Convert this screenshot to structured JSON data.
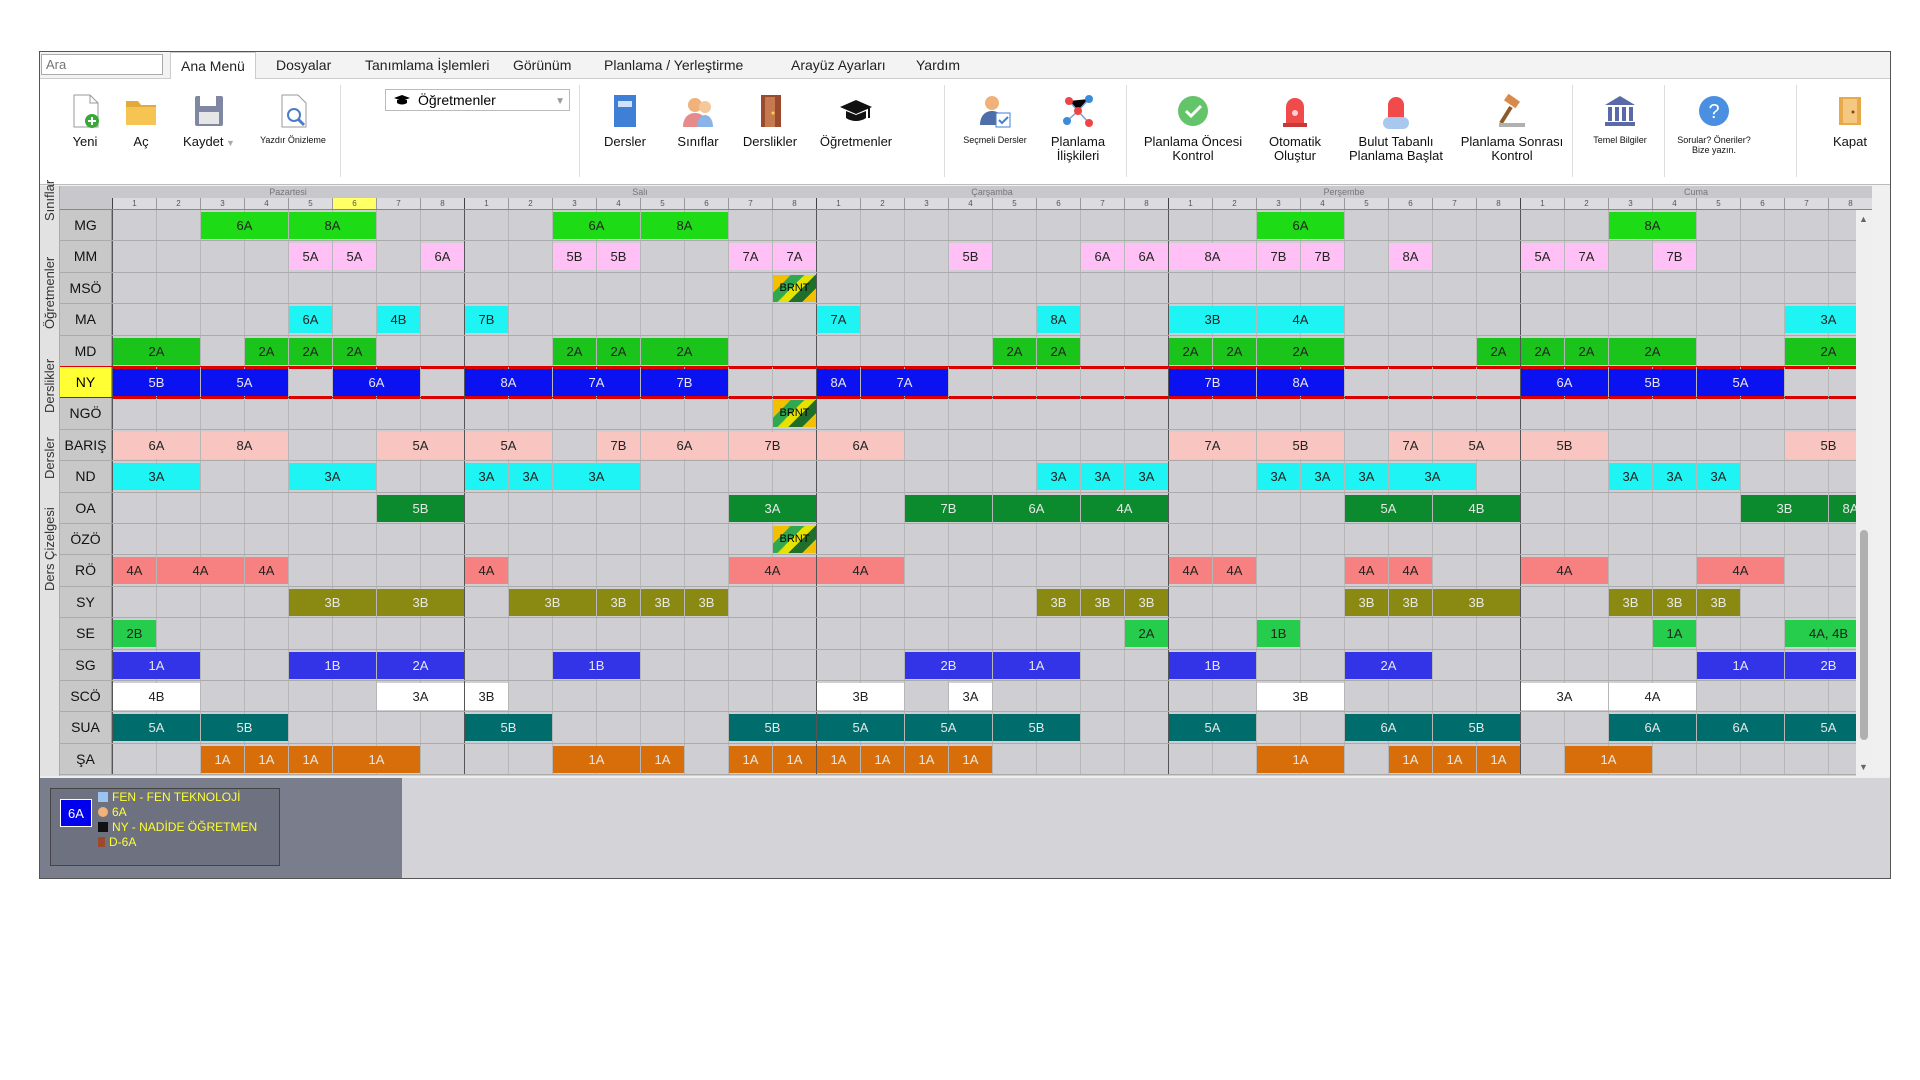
{
  "search": {
    "placeholder": "Ara"
  },
  "menu": [
    "Ana Menü",
    "Dosyalar",
    "Tanımlama İşlemleri",
    "Görünüm",
    "Planlama / Yerleştirme",
    "Arayüz Ayarları",
    "Yardım"
  ],
  "ribbon": {
    "new": "Yeni",
    "open": "Aç",
    "save": "Kaydet",
    "print_preview": "Yazdır Önizleme",
    "selector": "Öğretmenler",
    "lessons": "Dersler",
    "classes": "Sınıflar",
    "classrooms": "Derslikler",
    "teachers": "Öğretmenler",
    "elective": "Seçmeli Dersler",
    "relations": "Planlama İlişkileri",
    "precheck": "Planlama Öncesi Kontrol",
    "auto": "Otomatik Oluştur",
    "cloud": "Bulut Tabanlı Planlama Başlat",
    "postcheck": "Planlama Sonrası Kontrol",
    "basic": "Temel Bilgiler",
    "questions": "Sorular? Öneriler? Bize yazın.",
    "close": "Kapat"
  },
  "side_tabs": [
    "Sınıflar",
    "Öğretmenler",
    "Derslikler",
    "Dersler",
    "Ders Çizelgesi"
  ],
  "days": [
    "Pazartesi",
    "Salı",
    "Çarşamba",
    "Perşembe",
    "Cuma"
  ],
  "periods": [
    "1",
    "2",
    "3",
    "4",
    "5",
    "6",
    "7",
    "8"
  ],
  "highlighted_period": {
    "day": 0,
    "period": 6
  },
  "colors": {
    "green": "#1ddc16",
    "pink": "#ffc0f5",
    "cyan": "#1ff4f4",
    "limegreen": "#1bc41b",
    "blue": "#0b12f2",
    "salmon": "#f8c5c0",
    "darkgreen": "#0c8b2e",
    "red": "#f78080",
    "olive": "#8a8a12",
    "mint": "#26cc4b",
    "royal": "#3333e8",
    "white": "#ffffff",
    "teal": "#006c6c",
    "orange": "#d76e0a"
  },
  "rows": [
    {
      "name": "MG",
      "events": [
        [
          0,
          3,
          2,
          "6A",
          "green"
        ],
        [
          0,
          5,
          2,
          "8A",
          "green"
        ],
        [
          1,
          3,
          2,
          "6A",
          "green"
        ],
        [
          1,
          5,
          2,
          "8A",
          "green"
        ],
        [
          3,
          3,
          2,
          "6A",
          "green"
        ],
        [
          4,
          3,
          2,
          "8A",
          "green"
        ]
      ]
    },
    {
      "name": "MM",
      "events": [
        [
          0,
          5,
          1,
          "5A",
          "pink"
        ],
        [
          0,
          6,
          1,
          "5A",
          "pink"
        ],
        [
          0,
          8,
          1,
          "6A",
          "pink"
        ],
        [
          1,
          3,
          1,
          "5B",
          "pink"
        ],
        [
          1,
          4,
          1,
          "5B",
          "pink"
        ],
        [
          1,
          7,
          1,
          "7A",
          "pink"
        ],
        [
          1,
          8,
          1,
          "7A",
          "pink"
        ],
        [
          2,
          4,
          1,
          "5B",
          "pink"
        ],
        [
          2,
          7,
          1,
          "6A",
          "pink"
        ],
        [
          2,
          8,
          1,
          "6A",
          "pink"
        ],
        [
          3,
          1,
          2,
          "8A",
          "pink"
        ],
        [
          3,
          3,
          1,
          "7B",
          "pink"
        ],
        [
          3,
          4,
          1,
          "7B",
          "pink"
        ],
        [
          3,
          6,
          1,
          "8A",
          "pink"
        ],
        [
          4,
          1,
          1,
          "5A",
          "pink"
        ],
        [
          4,
          2,
          1,
          "7A",
          "pink"
        ],
        [
          4,
          4,
          1,
          "7B",
          "pink"
        ]
      ]
    },
    {
      "name": "MSÖ",
      "events": [
        [
          1,
          8,
          1,
          "BRNT",
          "brnt"
        ]
      ]
    },
    {
      "name": "MA",
      "events": [
        [
          0,
          5,
          1,
          "6A",
          "cyan"
        ],
        [
          0,
          7,
          1,
          "4B",
          "cyan"
        ],
        [
          1,
          1,
          1,
          "7B",
          "cyan"
        ],
        [
          2,
          1,
          1,
          "7A",
          "cyan"
        ],
        [
          2,
          6,
          1,
          "8A",
          "cyan"
        ],
        [
          3,
          1,
          2,
          "3B",
          "cyan"
        ],
        [
          3,
          3,
          2,
          "4A",
          "cyan"
        ],
        [
          4,
          7,
          2,
          "3A",
          "cyan"
        ]
      ]
    },
    {
      "name": "MD",
      "events": [
        [
          0,
          1,
          2,
          "2A",
          "limegreen"
        ],
        [
          0,
          4,
          1,
          "2A",
          "limegreen"
        ],
        [
          0,
          5,
          1,
          "2A",
          "limegreen"
        ],
        [
          0,
          6,
          1,
          "2A",
          "limegreen"
        ],
        [
          1,
          3,
          1,
          "2A",
          "limegreen"
        ],
        [
          1,
          4,
          1,
          "2A",
          "limegreen"
        ],
        [
          1,
          5,
          2,
          "2A",
          "limegreen"
        ],
        [
          2,
          5,
          1,
          "2A",
          "limegreen"
        ],
        [
          2,
          6,
          1,
          "2A",
          "limegreen"
        ],
        [
          3,
          1,
          1,
          "2A",
          "limegreen"
        ],
        [
          3,
          2,
          1,
          "2A",
          "limegreen"
        ],
        [
          3,
          3,
          2,
          "2A",
          "limegreen"
        ],
        [
          3,
          8,
          1,
          "2A",
          "limegreen"
        ],
        [
          4,
          1,
          1,
          "2A",
          "limegreen"
        ],
        [
          4,
          2,
          1,
          "2A",
          "limegreen"
        ],
        [
          4,
          3,
          2,
          "2A",
          "limegreen"
        ],
        [
          4,
          7,
          2,
          "2A",
          "limegreen"
        ]
      ]
    },
    {
      "name": "NY",
      "selected": true,
      "events": [
        [
          0,
          1,
          2,
          "5B",
          "blue"
        ],
        [
          0,
          3,
          2,
          "5A",
          "blue"
        ],
        [
          0,
          6,
          2,
          "6A",
          "blue"
        ],
        [
          1,
          1,
          2,
          "8A",
          "blue"
        ],
        [
          1,
          3,
          2,
          "7A",
          "blue"
        ],
        [
          1,
          5,
          2,
          "7B",
          "blue"
        ],
        [
          2,
          1,
          1,
          "8A",
          "blue"
        ],
        [
          2,
          2,
          2,
          "7A",
          "blue"
        ],
        [
          3,
          1,
          2,
          "7B",
          "blue"
        ],
        [
          3,
          3,
          2,
          "8A",
          "blue"
        ],
        [
          4,
          1,
          2,
          "6A",
          "blue"
        ],
        [
          4,
          3,
          2,
          "5B",
          "blue"
        ],
        [
          4,
          5,
          2,
          "5A",
          "blue"
        ]
      ]
    },
    {
      "name": "NGÖ",
      "events": [
        [
          1,
          8,
          1,
          "BRNT",
          "brnt"
        ]
      ]
    },
    {
      "name": "BARIŞ",
      "events": [
        [
          0,
          1,
          2,
          "6A",
          "salmon"
        ],
        [
          0,
          3,
          2,
          "8A",
          "salmon"
        ],
        [
          0,
          7,
          2,
          "5A",
          "salmon"
        ],
        [
          1,
          1,
          2,
          "5A",
          "salmon"
        ],
        [
          1,
          4,
          1,
          "7B",
          "salmon"
        ],
        [
          1,
          5,
          2,
          "6A",
          "salmon"
        ],
        [
          1,
          7,
          2,
          "7B",
          "salmon"
        ],
        [
          2,
          1,
          2,
          "6A",
          "salmon"
        ],
        [
          3,
          1,
          2,
          "7A",
          "salmon"
        ],
        [
          3,
          3,
          2,
          "5B",
          "salmon"
        ],
        [
          3,
          6,
          1,
          "7A",
          "salmon"
        ],
        [
          3,
          7,
          2,
          "5A",
          "salmon"
        ],
        [
          4,
          1,
          2,
          "5B",
          "salmon"
        ],
        [
          4,
          7,
          2,
          "5B",
          "salmon"
        ]
      ]
    },
    {
      "name": "ND",
      "events": [
        [
          0,
          1,
          2,
          "3A",
          "cyan"
        ],
        [
          0,
          5,
          2,
          "3A",
          "cyan"
        ],
        [
          1,
          1,
          1,
          "3A",
          "cyan"
        ],
        [
          1,
          2,
          1,
          "3A",
          "cyan"
        ],
        [
          1,
          3,
          2,
          "3A",
          "cyan"
        ],
        [
          2,
          6,
          1,
          "3A",
          "cyan"
        ],
        [
          2,
          7,
          1,
          "3A",
          "cyan"
        ],
        [
          2,
          8,
          1,
          "3A",
          "cyan"
        ],
        [
          3,
          3,
          1,
          "3A",
          "cyan"
        ],
        [
          3,
          4,
          1,
          "3A",
          "cyan"
        ],
        [
          3,
          5,
          1,
          "3A",
          "cyan"
        ],
        [
          3,
          6,
          2,
          "3A",
          "cyan"
        ],
        [
          4,
          3,
          1,
          "3A",
          "cyan"
        ],
        [
          4,
          4,
          1,
          "3A",
          "cyan"
        ],
        [
          4,
          5,
          1,
          "3A",
          "cyan"
        ]
      ]
    },
    {
      "name": "OA",
      "events": [
        [
          0,
          7,
          2,
          "5B",
          "darkgreen"
        ],
        [
          1,
          7,
          2,
          "3A",
          "darkgreen"
        ],
        [
          2,
          3,
          2,
          "7B",
          "darkgreen"
        ],
        [
          2,
          5,
          2,
          "6A",
          "darkgreen"
        ],
        [
          2,
          7,
          2,
          "4A",
          "darkgreen"
        ],
        [
          3,
          5,
          2,
          "5A",
          "darkgreen"
        ],
        [
          3,
          7,
          2,
          "4B",
          "darkgreen"
        ],
        [
          4,
          6,
          2,
          "3B",
          "darkgreen"
        ],
        [
          4,
          8,
          1,
          "8A",
          "darkgreen"
        ]
      ]
    },
    {
      "name": "ÖZÖ",
      "events": [
        [
          1,
          8,
          1,
          "BRNT",
          "brnt"
        ]
      ]
    },
    {
      "name": "RÖ",
      "events": [
        [
          0,
          1,
          1,
          "4A",
          "red"
        ],
        [
          0,
          2,
          2,
          "4A",
          "red"
        ],
        [
          0,
          4,
          1,
          "4A",
          "red"
        ],
        [
          1,
          1,
          1,
          "4A",
          "red"
        ],
        [
          1,
          7,
          2,
          "4A",
          "red"
        ],
        [
          2,
          1,
          2,
          "4A",
          "red"
        ],
        [
          3,
          1,
          1,
          "4A",
          "red"
        ],
        [
          3,
          2,
          1,
          "4A",
          "red"
        ],
        [
          3,
          5,
          1,
          "4A",
          "red"
        ],
        [
          3,
          6,
          1,
          "4A",
          "red"
        ],
        [
          4,
          1,
          2,
          "4A",
          "red"
        ],
        [
          4,
          5,
          2,
          "4A",
          "red"
        ]
      ]
    },
    {
      "name": "SY",
      "events": [
        [
          0,
          5,
          2,
          "3B",
          "olive"
        ],
        [
          0,
          7,
          2,
          "3B",
          "olive"
        ],
        [
          1,
          2,
          2,
          "3B",
          "olive"
        ],
        [
          1,
          4,
          1,
          "3B",
          "olive"
        ],
        [
          1,
          5,
          1,
          "3B",
          "olive"
        ],
        [
          1,
          6,
          1,
          "3B",
          "olive"
        ],
        [
          2,
          6,
          1,
          "3B",
          "olive"
        ],
        [
          2,
          7,
          1,
          "3B",
          "olive"
        ],
        [
          2,
          8,
          1,
          "3B",
          "olive"
        ],
        [
          3,
          5,
          1,
          "3B",
          "olive"
        ],
        [
          3,
          6,
          1,
          "3B",
          "olive"
        ],
        [
          3,
          7,
          2,
          "3B",
          "olive"
        ],
        [
          4,
          3,
          1,
          "3B",
          "olive"
        ],
        [
          4,
          4,
          1,
          "3B",
          "olive"
        ],
        [
          4,
          5,
          1,
          "3B",
          "olive"
        ]
      ]
    },
    {
      "name": "SE",
      "events": [
        [
          0,
          1,
          1,
          "2B",
          "mint"
        ],
        [
          2,
          8,
          1,
          "2A",
          "mint"
        ],
        [
          3,
          3,
          1,
          "1B",
          "mint"
        ],
        [
          4,
          4,
          1,
          "1A",
          "mint"
        ],
        [
          4,
          7,
          2,
          "4A, 4B",
          "mint"
        ]
      ]
    },
    {
      "name": "SG",
      "events": [
        [
          0,
          1,
          2,
          "1A",
          "royal"
        ],
        [
          0,
          5,
          2,
          "1B",
          "royal"
        ],
        [
          0,
          7,
          2,
          "2A",
          "royal"
        ],
        [
          1,
          3,
          2,
          "1B",
          "royal"
        ],
        [
          2,
          3,
          2,
          "2B",
          "royal"
        ],
        [
          2,
          5,
          2,
          "1A",
          "royal"
        ],
        [
          3,
          1,
          2,
          "1B",
          "royal"
        ],
        [
          3,
          5,
          2,
          "2A",
          "royal"
        ],
        [
          4,
          5,
          2,
          "1A",
          "royal"
        ],
        [
          4,
          7,
          2,
          "2B",
          "royal"
        ]
      ]
    },
    {
      "name": "SCÖ",
      "events": [
        [
          0,
          1,
          2,
          "4B",
          "white"
        ],
        [
          0,
          7,
          2,
          "3A",
          "white"
        ],
        [
          1,
          1,
          1,
          "3B",
          "white"
        ],
        [
          2,
          1,
          2,
          "3B",
          "white"
        ],
        [
          2,
          4,
          1,
          "3A",
          "white"
        ],
        [
          3,
          3,
          2,
          "3B",
          "white"
        ],
        [
          4,
          1,
          2,
          "3A",
          "white"
        ],
        [
          4,
          3,
          2,
          "4A",
          "white"
        ]
      ]
    },
    {
      "name": "SUA",
      "events": [
        [
          0,
          1,
          2,
          "5A",
          "teal"
        ],
        [
          0,
          3,
          2,
          "5B",
          "teal"
        ],
        [
          1,
          1,
          2,
          "5B",
          "teal"
        ],
        [
          1,
          7,
          2,
          "5B",
          "teal"
        ],
        [
          2,
          1,
          2,
          "5A",
          "teal"
        ],
        [
          2,
          3,
          2,
          "5A",
          "teal"
        ],
        [
          2,
          5,
          2,
          "5B",
          "teal"
        ],
        [
          3,
          1,
          2,
          "5A",
          "teal"
        ],
        [
          3,
          5,
          2,
          "6A",
          "teal"
        ],
        [
          3,
          7,
          2,
          "5B",
          "teal"
        ],
        [
          4,
          3,
          2,
          "6A",
          "teal"
        ],
        [
          4,
          5,
          2,
          "6A",
          "teal"
        ],
        [
          4,
          7,
          2,
          "5A",
          "teal"
        ]
      ]
    },
    {
      "name": "ŞA",
      "events": [
        [
          0,
          3,
          1,
          "1A",
          "orange"
        ],
        [
          0,
          4,
          1,
          "1A",
          "orange"
        ],
        [
          0,
          5,
          1,
          "1A",
          "orange"
        ],
        [
          0,
          6,
          2,
          "1A",
          "orange"
        ],
        [
          1,
          3,
          2,
          "1A",
          "orange"
        ],
        [
          1,
          5,
          1,
          "1A",
          "orange"
        ],
        [
          1,
          7,
          1,
          "1A",
          "orange"
        ],
        [
          1,
          8,
          1,
          "1A",
          "orange"
        ],
        [
          2,
          1,
          1,
          "1A",
          "orange"
        ],
        [
          2,
          2,
          1,
          "1A",
          "orange"
        ],
        [
          2,
          3,
          1,
          "1A",
          "orange"
        ],
        [
          2,
          4,
          1,
          "1A",
          "orange"
        ],
        [
          3,
          3,
          2,
          "1A",
          "orange"
        ],
        [
          3,
          6,
          1,
          "1A",
          "orange"
        ],
        [
          3,
          7,
          1,
          "1A",
          "orange"
        ],
        [
          3,
          8,
          1,
          "1A",
          "orange"
        ],
        [
          4,
          2,
          2,
          "1A",
          "orange"
        ]
      ]
    }
  ],
  "info": {
    "badge": "6A",
    "lesson": "FEN - FEN TEKNOLOJİ",
    "class": "6A",
    "teacher": "NY - NADİDE ÖĞRETMEN",
    "room": "D-6A"
  }
}
